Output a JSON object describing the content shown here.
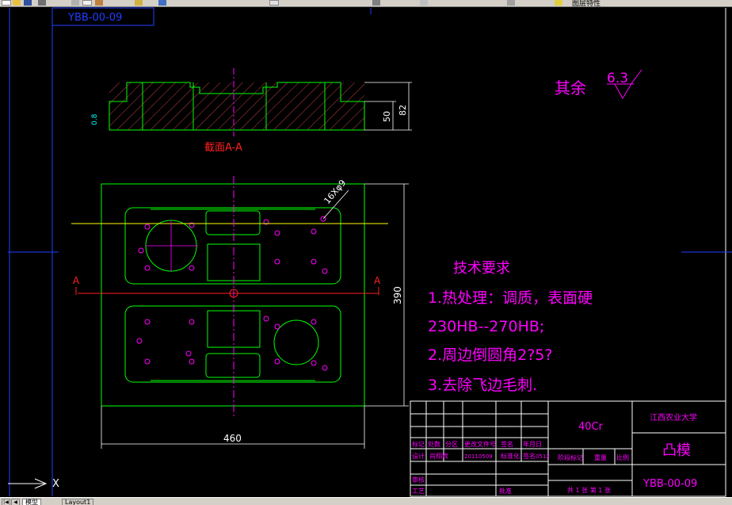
{
  "toolbar": {
    "icons": [
      "new-icon",
      "open-icon",
      "save-icon",
      "print-icon",
      "cut-icon",
      "copy-icon",
      "paste-icon",
      "undo-icon",
      "redo-icon",
      "pan-icon",
      "zoom-icon",
      "properties-icon",
      "layer-icon",
      "help-icon"
    ],
    "title_fragment": "图层特性"
  },
  "drawing": {
    "code_box": "YBB-00-09",
    "section_label": "截面A-A",
    "roughness_prefix": "其余",
    "roughness_value": "6.3",
    "small_roughness": "0.8",
    "dims": {
      "d50": "50",
      "d82": "82",
      "d390": "390",
      "d460": "460",
      "holes": "16Xφ9"
    },
    "section_marks": [
      "A",
      "A"
    ],
    "tech_requirements": {
      "heading": "技术要求",
      "lines": [
        "1.热处理：调质，表面硬",
        "230HB--270HB;",
        "2.周边倒圆角2?5?",
        "3.去除飞边毛刺."
      ]
    },
    "title_block": {
      "material": "40Cr",
      "school": "江西农业大学",
      "part_name": "凸模",
      "part_code": "YBB-00-09",
      "sheet_info": "共 1 张 第 1 张",
      "labels": {
        "mark": "标记",
        "count": "处数",
        "zone": "分区",
        "change_doc": "更改文件号",
        "sign": "签名",
        "date": "年月日",
        "design": "设计",
        "designer": "肖翔宾",
        "design_date": "20110509",
        "standardize": "标准化",
        "sign2": "签名",
        "date2": "0512",
        "stage_mark": "阶段标记",
        "weight": "重量",
        "scale": "比例",
        "review": "审核",
        "process": "工艺",
        "approve": "批准"
      }
    }
  },
  "bottom": {
    "tabs": [
      "模型",
      "Layout1"
    ],
    "ucs_axis": "X"
  }
}
